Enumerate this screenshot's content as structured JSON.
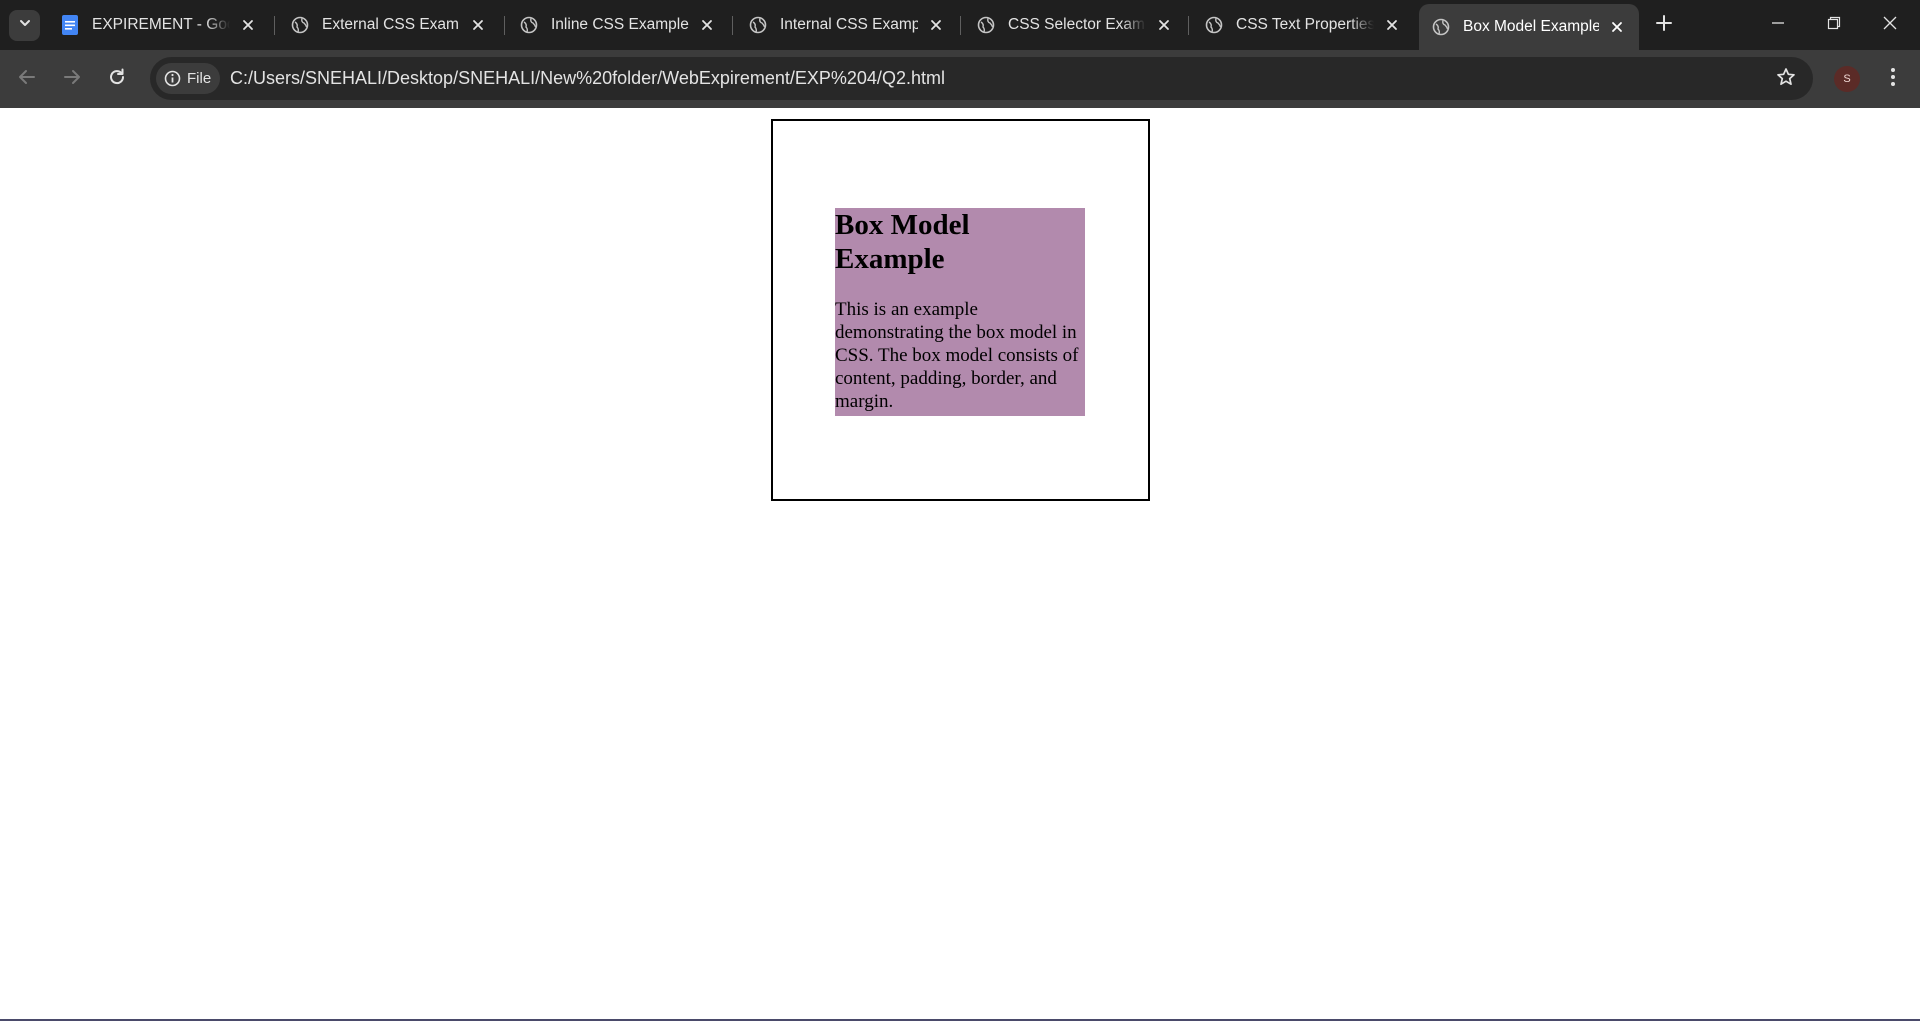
{
  "browser": {
    "tabs": [
      {
        "title": "EXPIREMENT - Googl",
        "icon": "google-docs-icon",
        "active": false
      },
      {
        "title": "External CSS Example",
        "icon": "globe-icon",
        "active": false
      },
      {
        "title": "Inline CSS Example",
        "icon": "globe-icon",
        "active": false
      },
      {
        "title": "Internal CSS Example",
        "icon": "globe-icon",
        "active": false
      },
      {
        "title": "CSS Selector Example",
        "icon": "globe-icon",
        "active": false
      },
      {
        "title": "CSS Text Properties S",
        "icon": "globe-icon",
        "active": false
      },
      {
        "title": "Box Model Example",
        "icon": "globe-icon",
        "active": true
      }
    ],
    "site_chip_label": "File",
    "url": "C:/Users/SNEHALI/Desktop/SNEHALI/New%20folder/WebExpirement/EXP%204/Q2.html",
    "profile_initial": "S",
    "colors": {
      "tabstrip_bg": "#1f1f1f",
      "toolbar_bg": "#3c3c3c",
      "omnibox_bg": "#282828",
      "avatar_bg": "#5b2b27"
    }
  },
  "page": {
    "heading": "Box Model Example",
    "paragraph": "This is an example demonstrating the box model in CSS. The box model consists of content, padding, border, and margin.",
    "colors": {
      "content_bg": "#b28aad",
      "border": "#000000"
    }
  }
}
